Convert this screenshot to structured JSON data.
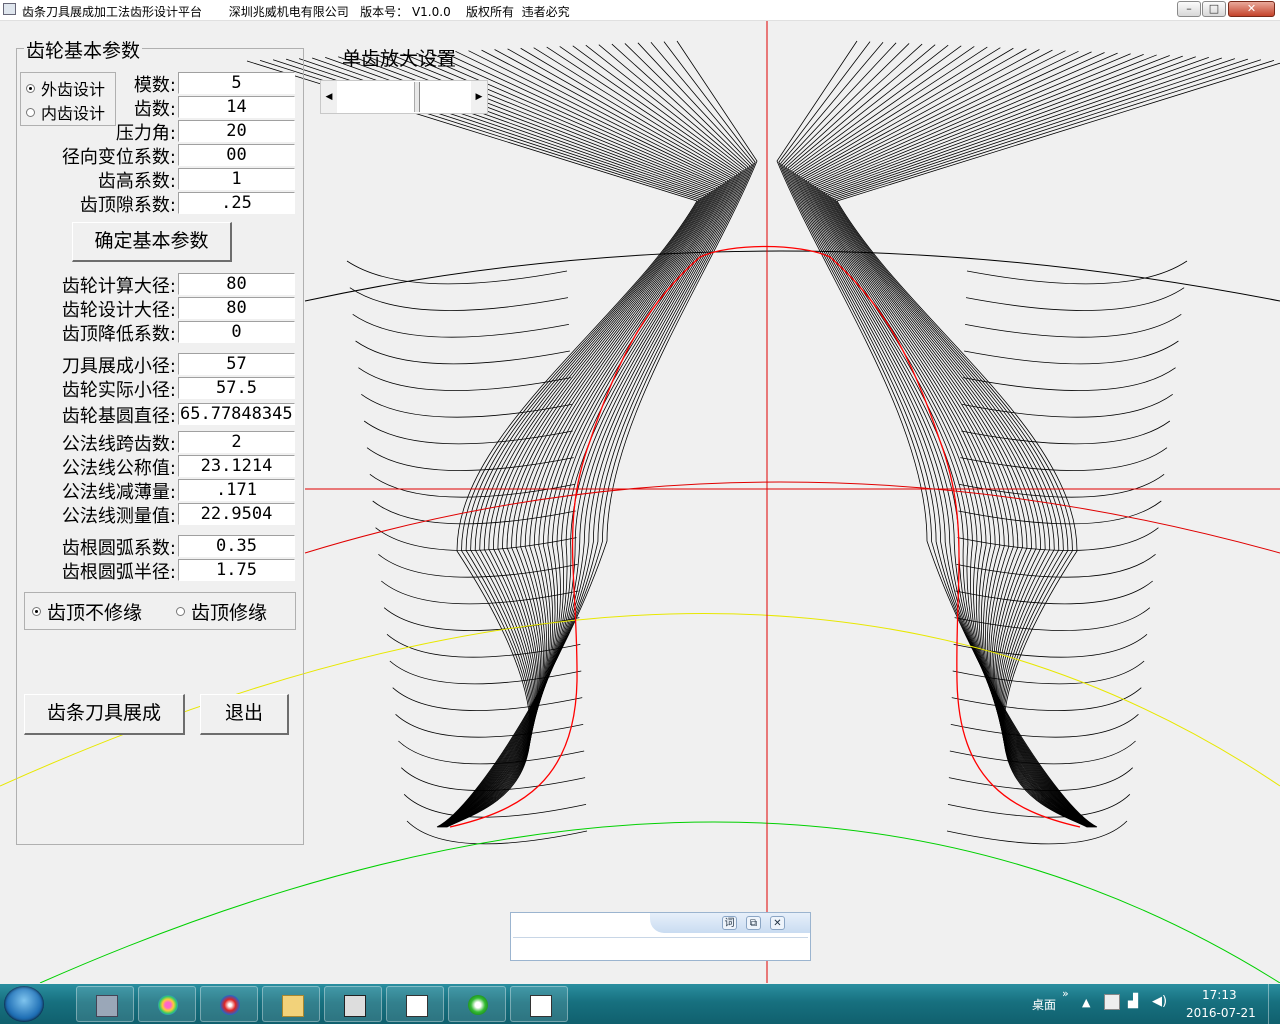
{
  "window": {
    "title": "齿条刀具展成加工法齿形设计平台       深圳兆威机电有限公司   版本号： V1.0.0    版权所有  违者必究",
    "controls": {
      "minimize": "–",
      "maximize": "□",
      "close": "✕"
    }
  },
  "params_panel": {
    "legend": "齿轮基本参数",
    "design_type": {
      "outer": "外齿设计",
      "inner": "内齿设计",
      "selected": "outer"
    },
    "fields": [
      {
        "label": "模数:",
        "value": "5"
      },
      {
        "label": "齿数:",
        "value": "14"
      },
      {
        "label": "压力角:",
        "value": "20"
      },
      {
        "label": "径向变位系数:",
        "value": "00"
      },
      {
        "label": "齿高系数:",
        "value": "1"
      },
      {
        "label": "齿顶隙系数:",
        "value": ".25"
      }
    ],
    "confirm_button": "确定基本参数",
    "calc_fields": [
      {
        "label": "齿轮计算大径:",
        "value": "80"
      },
      {
        "label": "齿轮设计大径:",
        "value": "80"
      },
      {
        "label": "齿顶降低系数:",
        "value": "0"
      },
      {
        "label": "刀具展成小径:",
        "value": "57"
      },
      {
        "label": "齿轮实际小径:",
        "value": "57.5"
      },
      {
        "label": "齿轮基圆直径:",
        "value": "65.77848345"
      },
      {
        "label": "公法线跨齿数:",
        "value": "2"
      },
      {
        "label": "公法线公称值:",
        "value": "23.1214"
      },
      {
        "label": "公法线减薄量:",
        "value": ".171"
      },
      {
        "label": "公法线测量值:",
        "value": "22.9504"
      },
      {
        "label": "齿根圆弧系数:",
        "value": "0.35"
      },
      {
        "label": "齿根圆弧半径:",
        "value": "1.75"
      }
    ],
    "tip_mod": {
      "no_mod": "齿顶不修缘",
      "mod": "齿顶修缘",
      "selected": "no_mod"
    },
    "generate_button": "齿条刀具展成",
    "exit_button": "退出"
  },
  "zoom": {
    "label": "单齿放大设置"
  },
  "taskbar": {
    "tray_label": "桌面",
    "tray_chevron": "»",
    "time": "17:13",
    "date": "2016-07-21"
  },
  "popup": {
    "btn1": "词",
    "btn2": "⧉",
    "btn3": "✕"
  },
  "colors": {
    "axis": "#e00000",
    "pitch": "#e8e800",
    "root": "#00d000",
    "profile": "#ff0000"
  }
}
